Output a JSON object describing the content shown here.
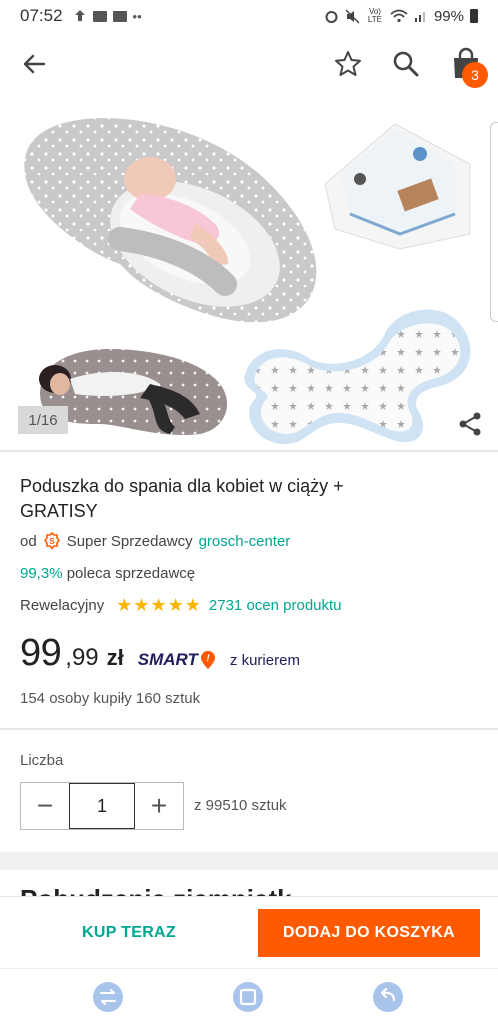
{
  "status_bar": {
    "time": "07:52",
    "left_icons": [
      "upload-icon",
      "mail-icon",
      "mail-icon",
      "more-dots-icon"
    ],
    "right_icons": [
      "alarm-icon",
      "mute-icon",
      "volte-icon",
      "wifi-icon",
      "signal-icon"
    ],
    "volte": "Vo)\nLTE",
    "battery": "99%"
  },
  "app_bar": {
    "icons": [
      "back-arrow-icon",
      "star-outline-icon",
      "search-icon",
      "shopping-bag-icon"
    ],
    "cart_count": "3"
  },
  "gallery": {
    "counter": "1/16",
    "images": [
      "pregnancy-pillow-baby-nest",
      "muslin-swaddles",
      "woman-with-pillow",
      "butterfly-baby-pillow"
    ]
  },
  "product": {
    "title": "Poduszka do spania dla kobiet w ciąży + GRATISY",
    "seller_prefix": "od",
    "seller_badge": "Super Sprzedawcy",
    "seller_name": "grosch-center",
    "recommend_pct": "99,3%",
    "recommend_text": "poleca sprzedawcę",
    "rating_label": "Rewelacyjny",
    "stars": 5,
    "rating_count": "2731 ocen produktu",
    "price_main": "99",
    "price_decimal": ",99",
    "currency": "zł",
    "smart_label": "SMART",
    "delivery": "z kurierem",
    "bought_text": "154 osoby kupiły 160 sztuk"
  },
  "quantity": {
    "label": "Liczba",
    "minus": "−",
    "value": "1",
    "plus": "+",
    "stock": "z 99510 sztuk"
  },
  "next_section_title": "Pobudzenie ziemniątk",
  "actions": {
    "buy_now": "KUP TERAZ",
    "add_to_cart": "DODAJ DO KOSZYKA"
  },
  "colors": {
    "accent_orange": "#ff5a00",
    "accent_teal": "#00a790",
    "star_yellow": "#f7b500",
    "smart_navy": "#1e1e5a"
  }
}
